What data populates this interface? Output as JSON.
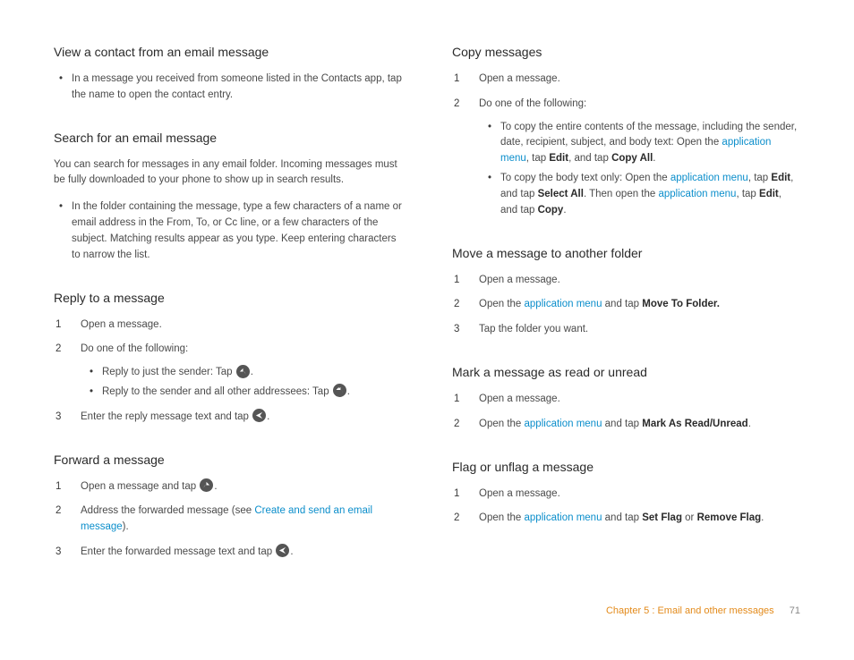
{
  "left": {
    "sec1": {
      "title": "View a contact from an email message",
      "b1": "In a message you received from someone listed in the Contacts app, tap the name to open the contact entry."
    },
    "sec2": {
      "title": "Search for an email message",
      "lead": "You can search for messages in any email folder. Incoming messages must be fully downloaded to your phone to show up in search results.",
      "b1": "In the folder containing the message, type a few characters of a name or email address in the From, To, or Cc line, or a few characters of the subject. Matching results appear as you type. Keep entering characters to narrow the list."
    },
    "sec3": {
      "title": "Reply to a message",
      "s1": "Open a message.",
      "s2": "Do one of the following:",
      "s2_b1a": "Reply to just the sender: Tap ",
      "s2_b1b": ".",
      "s2_b2a": "Reply to the sender and all other addressees: Tap ",
      "s2_b2b": ".",
      "s3a": "Enter the reply message text and tap ",
      "s3b": "."
    },
    "sec4": {
      "title": "Forward a message",
      "s1a": "Open a message and tap ",
      "s1b": ".",
      "s2a": "Address the forwarded message (see ",
      "s2_link": "Create and send an email message",
      "s2b": ").",
      "s3a": "Enter the forwarded message text and tap ",
      "s3b": "."
    }
  },
  "right": {
    "sec1": {
      "title": "Copy messages",
      "s1": "Open a message.",
      "s2": "Do one of the following:",
      "s2_b1a": "To copy the entire contents of the message, including the sender, date, recipient, subject, and body text: Open the ",
      "s2_b1_link": "application menu",
      "s2_b1b": ", tap ",
      "s2_b1_bold1": "Edit",
      "s2_b1c": ", and tap ",
      "s2_b1_bold2": "Copy All",
      "s2_b1d": ".",
      "s2_b2a": "To copy the body text only: Open the ",
      "s2_b2_link1": "application menu",
      "s2_b2b": ", tap ",
      "s2_b2_bold1": "Edit",
      "s2_b2c": ", and tap ",
      "s2_b2_bold2": "Select All",
      "s2_b2d": ". Then open the ",
      "s2_b2_link2": "application menu",
      "s2_b2e": ", tap ",
      "s2_b2_bold3": "Edit",
      "s2_b2f": ", and tap ",
      "s2_b2_bold4": "Copy",
      "s2_b2g": "."
    },
    "sec2": {
      "title": "Move a message to another folder",
      "s1": "Open a message.",
      "s2a": "Open the ",
      "s2_link": "application menu",
      "s2b": " and tap ",
      "s2_bold": "Move To Folder.",
      "s3": "Tap the folder you want."
    },
    "sec3": {
      "title": "Mark a message as read or unread",
      "s1": "Open a message.",
      "s2a": "Open the ",
      "s2_link": "application menu",
      "s2b": " and tap ",
      "s2_bold": "Mark As Read/Unread",
      "s2c": "."
    },
    "sec4": {
      "title": "Flag or unflag a message",
      "s1": "Open a message.",
      "s2a": "Open the ",
      "s2_link": "application menu",
      "s2b": " and tap ",
      "s2_bold1": "Set Flag",
      "s2c": " or ",
      "s2_bold2": "Remove Flag",
      "s2d": "."
    }
  },
  "footer": {
    "chapter": "Chapter 5  :  Email and other messages",
    "page": "71"
  }
}
